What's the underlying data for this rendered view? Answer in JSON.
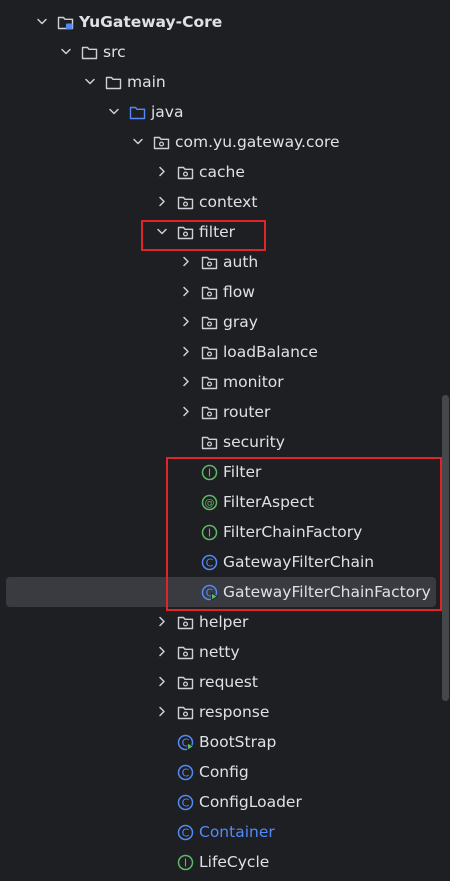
{
  "project_tree": {
    "nodes": [
      {
        "label": "YuGateway-Core",
        "icon": "module-folder-icon",
        "chevron": "down",
        "level": 0,
        "bold": true
      },
      {
        "label": "src",
        "icon": "folder-icon",
        "chevron": "down",
        "level": 1
      },
      {
        "label": "main",
        "icon": "folder-icon",
        "chevron": "down",
        "level": 2
      },
      {
        "label": "java",
        "icon": "source-root-folder-icon",
        "chevron": "down",
        "level": 3
      },
      {
        "label": "com.yu.gateway.core",
        "icon": "package-icon",
        "chevron": "down",
        "level": 4
      },
      {
        "label": "cache",
        "icon": "package-icon",
        "chevron": "right",
        "level": 5
      },
      {
        "label": "context",
        "icon": "package-icon",
        "chevron": "right",
        "level": 5
      },
      {
        "label": "filter",
        "icon": "package-icon",
        "chevron": "down",
        "level": 5
      },
      {
        "label": "auth",
        "icon": "package-icon",
        "chevron": "right",
        "level": 6
      },
      {
        "label": "flow",
        "icon": "package-icon",
        "chevron": "right",
        "level": 6
      },
      {
        "label": "gray",
        "icon": "package-icon",
        "chevron": "right",
        "level": 6
      },
      {
        "label": "loadBalance",
        "icon": "package-icon",
        "chevron": "right",
        "level": 6
      },
      {
        "label": "monitor",
        "icon": "package-icon",
        "chevron": "right",
        "level": 6
      },
      {
        "label": "router",
        "icon": "package-icon",
        "chevron": "right",
        "level": 6
      },
      {
        "label": "security",
        "icon": "package-icon",
        "chevron": "none",
        "level": 6
      },
      {
        "label": "Filter",
        "icon": "interface-icon",
        "chevron": "none",
        "level": 6
      },
      {
        "label": "FilterAspect",
        "icon": "annotation-icon",
        "chevron": "none",
        "level": 6
      },
      {
        "label": "FilterChainFactory",
        "icon": "interface-icon",
        "chevron": "none",
        "level": 6
      },
      {
        "label": "GatewayFilterChain",
        "icon": "class-icon",
        "chevron": "none",
        "level": 6
      },
      {
        "label": "GatewayFilterChainFactory",
        "icon": "class-runnable-icon",
        "chevron": "none",
        "level": 6,
        "selected": true
      },
      {
        "label": "helper",
        "icon": "package-icon",
        "chevron": "right",
        "level": 5
      },
      {
        "label": "netty",
        "icon": "package-icon",
        "chevron": "right",
        "level": 5
      },
      {
        "label": "request",
        "icon": "package-icon",
        "chevron": "right",
        "level": 5
      },
      {
        "label": "response",
        "icon": "package-icon",
        "chevron": "right",
        "level": 5
      },
      {
        "label": "BootStrap",
        "icon": "class-runnable-icon",
        "chevron": "none",
        "level": 5
      },
      {
        "label": "Config",
        "icon": "class-icon",
        "chevron": "none",
        "level": 5
      },
      {
        "label": "ConfigLoader",
        "icon": "class-icon",
        "chevron": "none",
        "level": 5
      },
      {
        "label": "Container",
        "icon": "class-icon",
        "chevron": "none",
        "level": 5,
        "link": true
      },
      {
        "label": "LifeCycle",
        "icon": "interface-icon",
        "chevron": "none",
        "level": 5
      }
    ]
  },
  "colors": {
    "background": "#1e1f22",
    "text": "#dfe1e5",
    "selected_row": "#393b40",
    "highlight_box": "#e0252a",
    "folder_outline": "#ced0d6",
    "source_root": "#548af7",
    "interface_green": "#5fb865",
    "class_blue": "#548af7",
    "link_text": "#548af7"
  }
}
